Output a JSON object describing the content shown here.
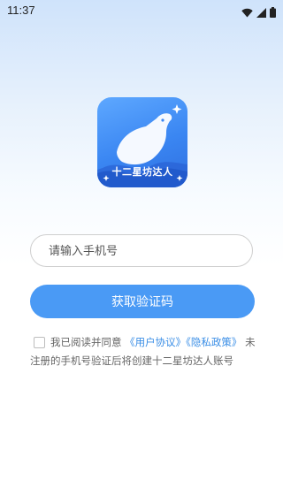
{
  "status_bar": {
    "time": "11:37",
    "icons": [
      "wifi-icon",
      "signal-icon",
      "battery-icon"
    ]
  },
  "logo": {
    "text": "十二星坊达人",
    "colors": {
      "top": "#5ea8ff",
      "bottom": "#2f6fe0"
    }
  },
  "form": {
    "phone_placeholder": "请输入手机号",
    "phone_value": "",
    "submit_label": "获取验证码"
  },
  "agreement": {
    "checked": false,
    "prefix": "我已阅读并同意",
    "user_agreement": "《用户协议》",
    "privacy_policy": "《隐私政策》",
    "suffix": "未注册的手机号验证后将创建十二星坊达人账号"
  },
  "colors": {
    "accent": "#4a9af5",
    "link": "#3a8ee6",
    "button_text": "#ffffff"
  }
}
